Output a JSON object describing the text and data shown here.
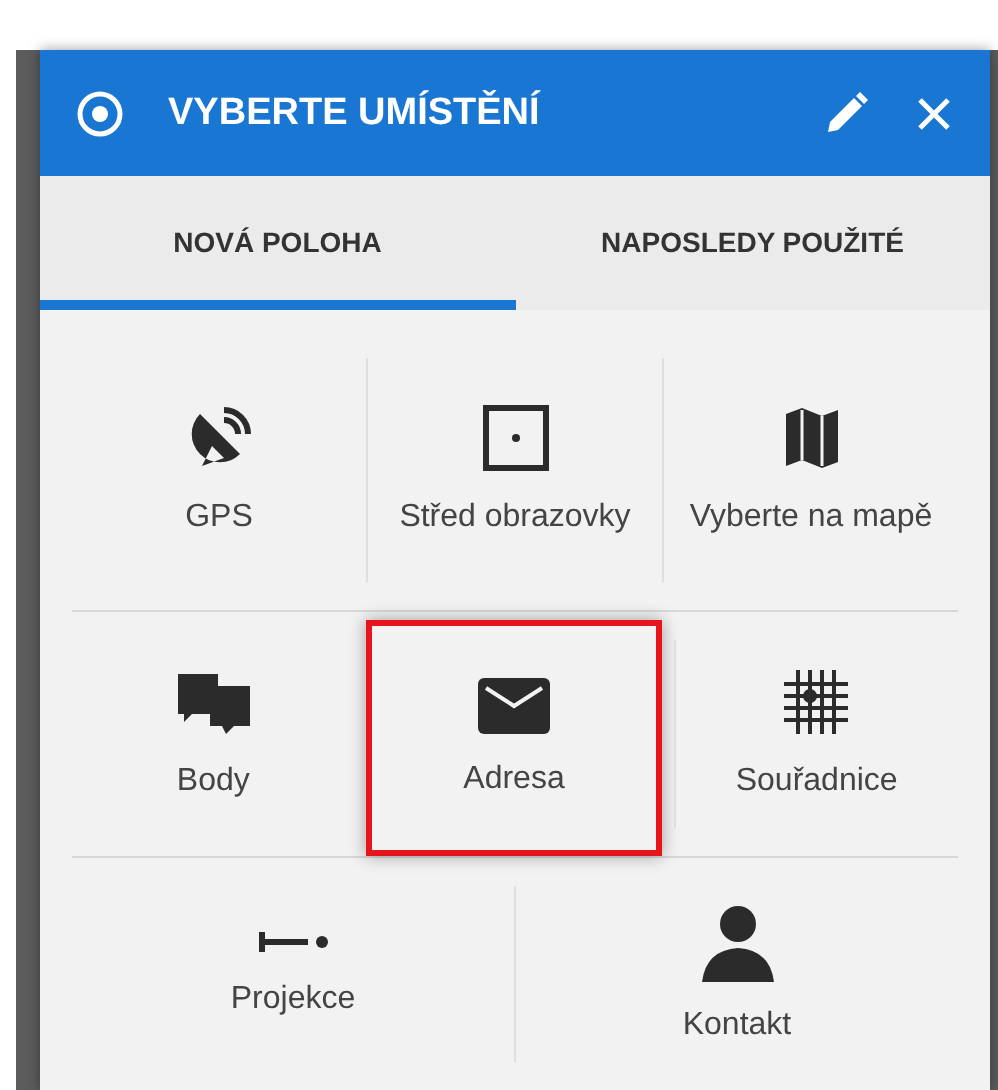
{
  "dialog": {
    "title": "VYBERTE UMÍSTĚNÍ"
  },
  "tabs": [
    {
      "label": "NOVÁ POLOHA",
      "selected": true
    },
    {
      "label": "NAPOSLEDY POUŽITÉ",
      "selected": false
    }
  ],
  "rows": [
    [
      {
        "kind": "gps",
        "label": "GPS",
        "highlighted": false
      },
      {
        "kind": "center",
        "label": "Střed obrazovky",
        "highlighted": false
      },
      {
        "kind": "map",
        "label": "Vyberte na mapě",
        "highlighted": false
      }
    ],
    [
      {
        "kind": "points",
        "label": "Body",
        "highlighted": false
      },
      {
        "kind": "mail",
        "label": "Adresa",
        "highlighted": true
      },
      {
        "kind": "grid",
        "label": "Souřadnice",
        "highlighted": false
      }
    ],
    [
      {
        "kind": "projection",
        "label": "Projekce",
        "highlighted": false
      },
      {
        "kind": "contact",
        "label": "Kontakt",
        "highlighted": false
      }
    ]
  ]
}
